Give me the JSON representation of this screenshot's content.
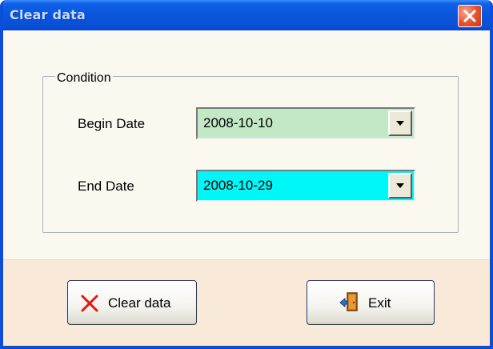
{
  "window": {
    "title": "Clear data"
  },
  "condition": {
    "legend": "Condition",
    "begin_label": "Begin Date",
    "begin_value": "2008-10-10",
    "begin_color": "#c2e8c6",
    "end_label": "End Date",
    "end_value": "2008-10-29",
    "end_color": "#00f7f7"
  },
  "buttons": {
    "clear_label": "Clear data",
    "clear_icon": "x-icon",
    "exit_label": "Exit",
    "exit_icon": "exit-door-icon"
  },
  "colors": {
    "titlebar": "#0a55dc",
    "client": "#fbf8ef",
    "bottom": "#f9e9d8",
    "clear_icon": "#dd1a1a"
  }
}
